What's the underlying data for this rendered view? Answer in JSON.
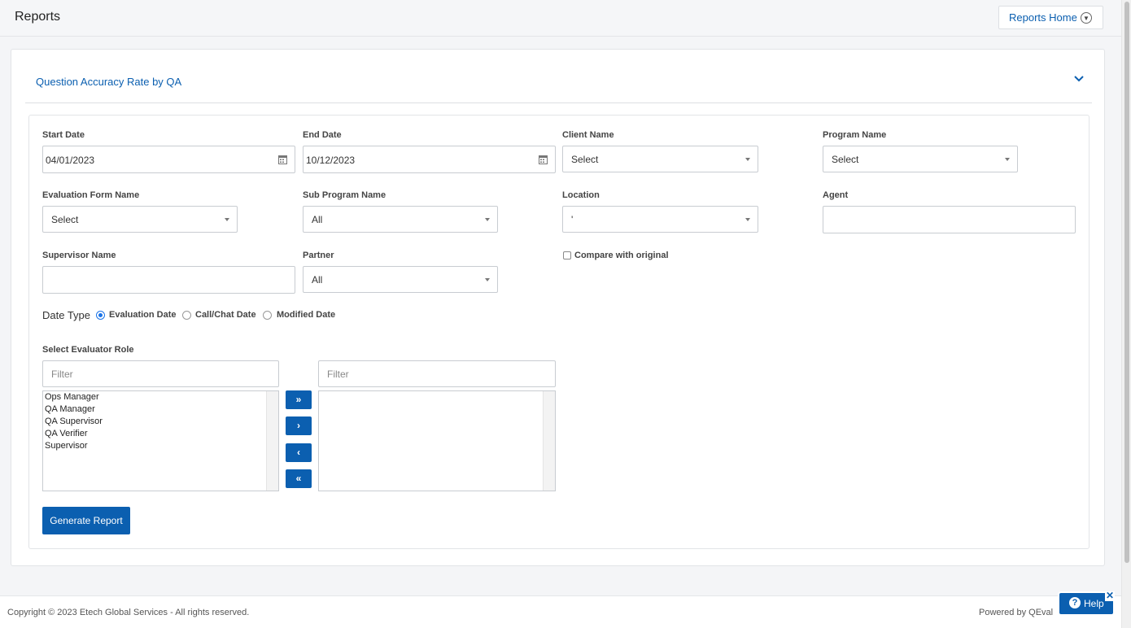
{
  "header": {
    "title": "Reports",
    "reports_home_label": "Reports Home"
  },
  "report": {
    "title": "Question Accuracy Rate by QA",
    "fields": {
      "start_date": {
        "label": "Start Date",
        "value": "04/01/2023"
      },
      "end_date": {
        "label": "End Date",
        "value": "10/12/2023"
      },
      "client_name": {
        "label": "Client Name",
        "value": "Select"
      },
      "program_name": {
        "label": "Program Name",
        "value": "Select"
      },
      "evaluation_form_name": {
        "label": "Evaluation Form Name",
        "value": "Select"
      },
      "sub_program_name": {
        "label": "Sub Program Name",
        "value": "All"
      },
      "location": {
        "label": "Location",
        "value": "'"
      },
      "agent": {
        "label": "Agent",
        "value": ""
      },
      "supervisor_name": {
        "label": "Supervisor Name",
        "value": ""
      },
      "partner": {
        "label": "Partner",
        "value": "All"
      },
      "compare_with_original": {
        "label": "Compare with original",
        "checked": false
      }
    },
    "date_type": {
      "label": "Date Type",
      "options": [
        {
          "label": "Evaluation Date",
          "selected": true
        },
        {
          "label": "Call/Chat Date",
          "selected": false
        },
        {
          "label": "Modified Date",
          "selected": false
        }
      ]
    },
    "evaluator_role": {
      "label": "Select Evaluator Role",
      "filter_placeholder": "Filter",
      "available": [
        "Ops Manager",
        "QA Manager",
        "QA Supervisor",
        "QA Verifier",
        "Supervisor"
      ],
      "selected": [],
      "buttons": {
        "move_all_right": "»",
        "move_right": "›",
        "move_left": "‹",
        "move_all_left": "«"
      }
    },
    "generate_label": "Generate Report"
  },
  "footer": {
    "copyright": "Copyright © 2023 Etech Global Services - All rights reserved.",
    "powered_by": "Powered by QEval",
    "help_label": "Help"
  },
  "colors": {
    "accent": "#0b5fb0",
    "radio_on": "#1a73e8"
  }
}
